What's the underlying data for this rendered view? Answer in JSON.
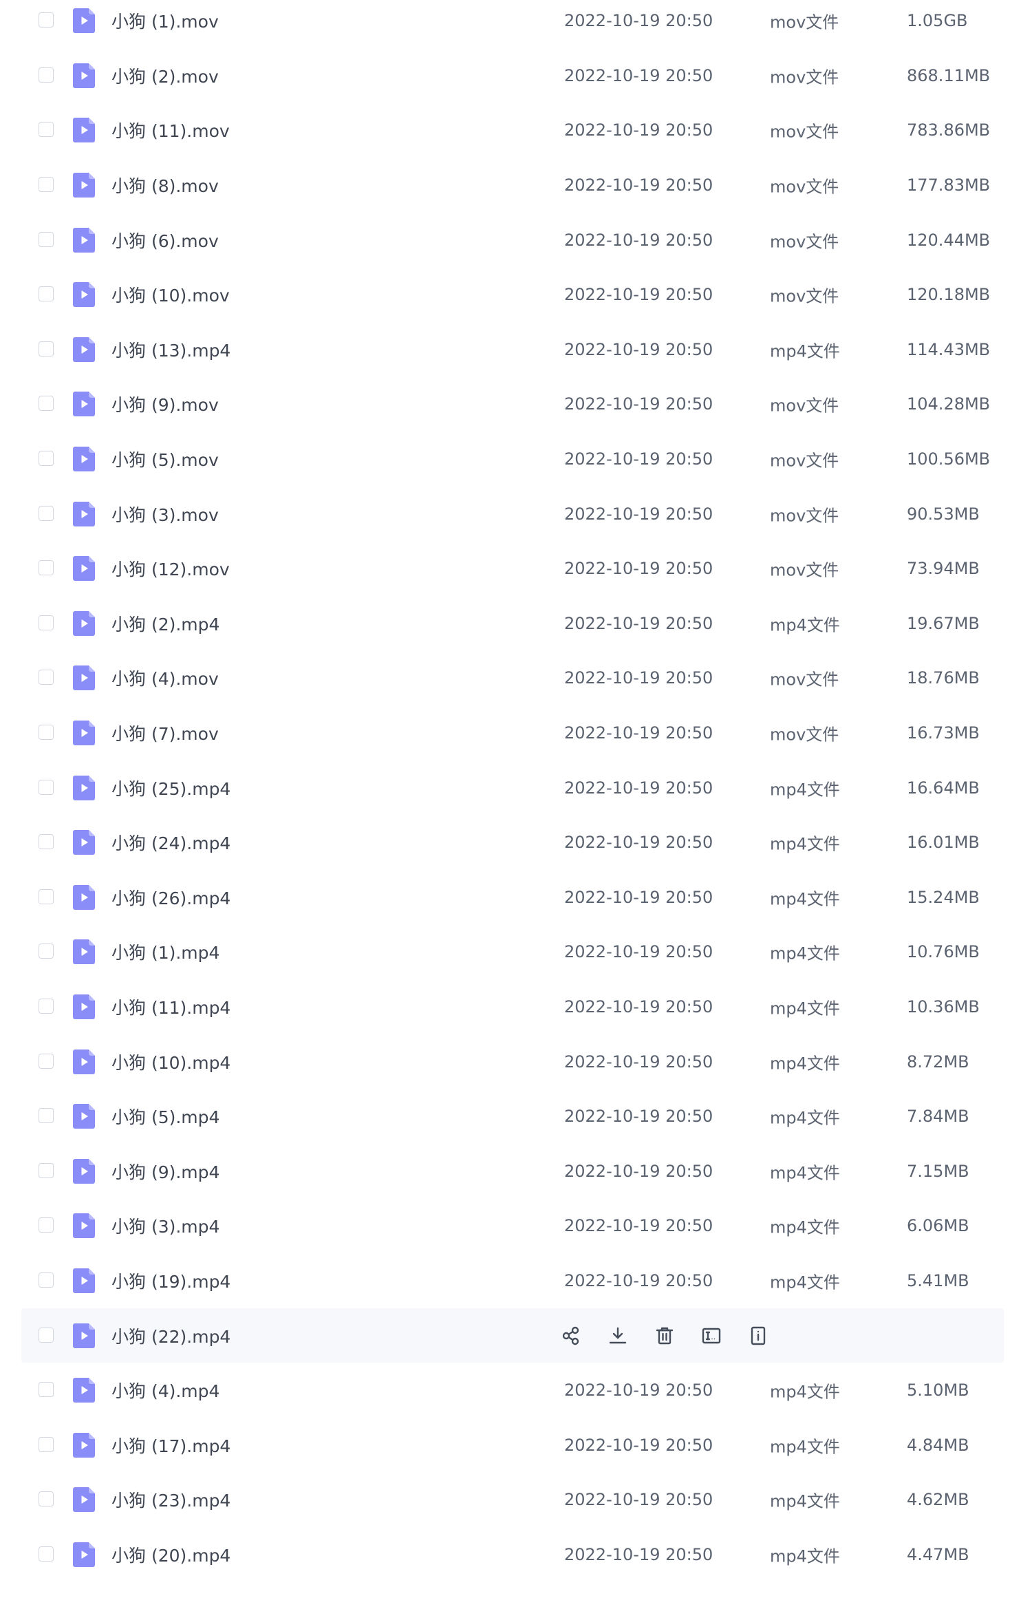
{
  "colors": {
    "icon_fill": "#8a8cf7",
    "icon_fold": "#b9baff",
    "icon_play": "#ffffff",
    "hover_background": "#f7f8fb",
    "action_icon": "#454d5a"
  },
  "hover_actions": [
    {
      "icon": "share-icon"
    },
    {
      "icon": "download-icon"
    },
    {
      "icon": "delete-icon"
    },
    {
      "icon": "rename-icon"
    },
    {
      "icon": "more-icon"
    }
  ],
  "files": [
    {
      "name": "小狗 (1).mov",
      "date": "2022-10-19 20:50",
      "type": "mov文件",
      "size": "1.05GB"
    },
    {
      "name": "小狗 (2).mov",
      "date": "2022-10-19 20:50",
      "type": "mov文件",
      "size": "868.11MB"
    },
    {
      "name": "小狗 (11).mov",
      "date": "2022-10-19 20:50",
      "type": "mov文件",
      "size": "783.86MB"
    },
    {
      "name": "小狗 (8).mov",
      "date": "2022-10-19 20:50",
      "type": "mov文件",
      "size": "177.83MB"
    },
    {
      "name": "小狗 (6).mov",
      "date": "2022-10-19 20:50",
      "type": "mov文件",
      "size": "120.44MB"
    },
    {
      "name": "小狗 (10).mov",
      "date": "2022-10-19 20:50",
      "type": "mov文件",
      "size": "120.18MB"
    },
    {
      "name": "小狗 (13).mp4",
      "date": "2022-10-19 20:50",
      "type": "mp4文件",
      "size": "114.43MB"
    },
    {
      "name": "小狗 (9).mov",
      "date": "2022-10-19 20:50",
      "type": "mov文件",
      "size": "104.28MB"
    },
    {
      "name": "小狗 (5).mov",
      "date": "2022-10-19 20:50",
      "type": "mov文件",
      "size": "100.56MB"
    },
    {
      "name": "小狗 (3).mov",
      "date": "2022-10-19 20:50",
      "type": "mov文件",
      "size": "90.53MB"
    },
    {
      "name": "小狗 (12).mov",
      "date": "2022-10-19 20:50",
      "type": "mov文件",
      "size": "73.94MB"
    },
    {
      "name": "小狗 (2).mp4",
      "date": "2022-10-19 20:50",
      "type": "mp4文件",
      "size": "19.67MB"
    },
    {
      "name": "小狗 (4).mov",
      "date": "2022-10-19 20:50",
      "type": "mov文件",
      "size": "18.76MB"
    },
    {
      "name": "小狗 (7).mov",
      "date": "2022-10-19 20:50",
      "type": "mov文件",
      "size": "16.73MB"
    },
    {
      "name": "小狗 (25).mp4",
      "date": "2022-10-19 20:50",
      "type": "mp4文件",
      "size": "16.64MB"
    },
    {
      "name": "小狗 (24).mp4",
      "date": "2022-10-19 20:50",
      "type": "mp4文件",
      "size": "16.01MB"
    },
    {
      "name": "小狗 (26).mp4",
      "date": "2022-10-19 20:50",
      "type": "mp4文件",
      "size": "15.24MB"
    },
    {
      "name": "小狗 (1).mp4",
      "date": "2022-10-19 20:50",
      "type": "mp4文件",
      "size": "10.76MB"
    },
    {
      "name": "小狗 (11).mp4",
      "date": "2022-10-19 20:50",
      "type": "mp4文件",
      "size": "10.36MB"
    },
    {
      "name": "小狗 (10).mp4",
      "date": "2022-10-19 20:50",
      "type": "mp4文件",
      "size": "8.72MB"
    },
    {
      "name": "小狗 (5).mp4",
      "date": "2022-10-19 20:50",
      "type": "mp4文件",
      "size": "7.84MB"
    },
    {
      "name": "小狗 (9).mp4",
      "date": "2022-10-19 20:50",
      "type": "mp4文件",
      "size": "7.15MB"
    },
    {
      "name": "小狗 (3).mp4",
      "date": "2022-10-19 20:50",
      "type": "mp4文件",
      "size": "6.06MB"
    },
    {
      "name": "小狗 (19).mp4",
      "date": "2022-10-19 20:50",
      "type": "mp4文件",
      "size": "5.41MB"
    },
    {
      "name": "小狗 (22).mp4",
      "hovered": true
    },
    {
      "name": "小狗 (4).mp4",
      "date": "2022-10-19 20:50",
      "type": "mp4文件",
      "size": "5.10MB"
    },
    {
      "name": "小狗 (17).mp4",
      "date": "2022-10-19 20:50",
      "type": "mp4文件",
      "size": "4.84MB"
    },
    {
      "name": "小狗 (23).mp4",
      "date": "2022-10-19 20:50",
      "type": "mp4文件",
      "size": "4.62MB"
    },
    {
      "name": "小狗 (20).mp4",
      "date": "2022-10-19 20:50",
      "type": "mp4文件",
      "size": "4.47MB"
    }
  ]
}
